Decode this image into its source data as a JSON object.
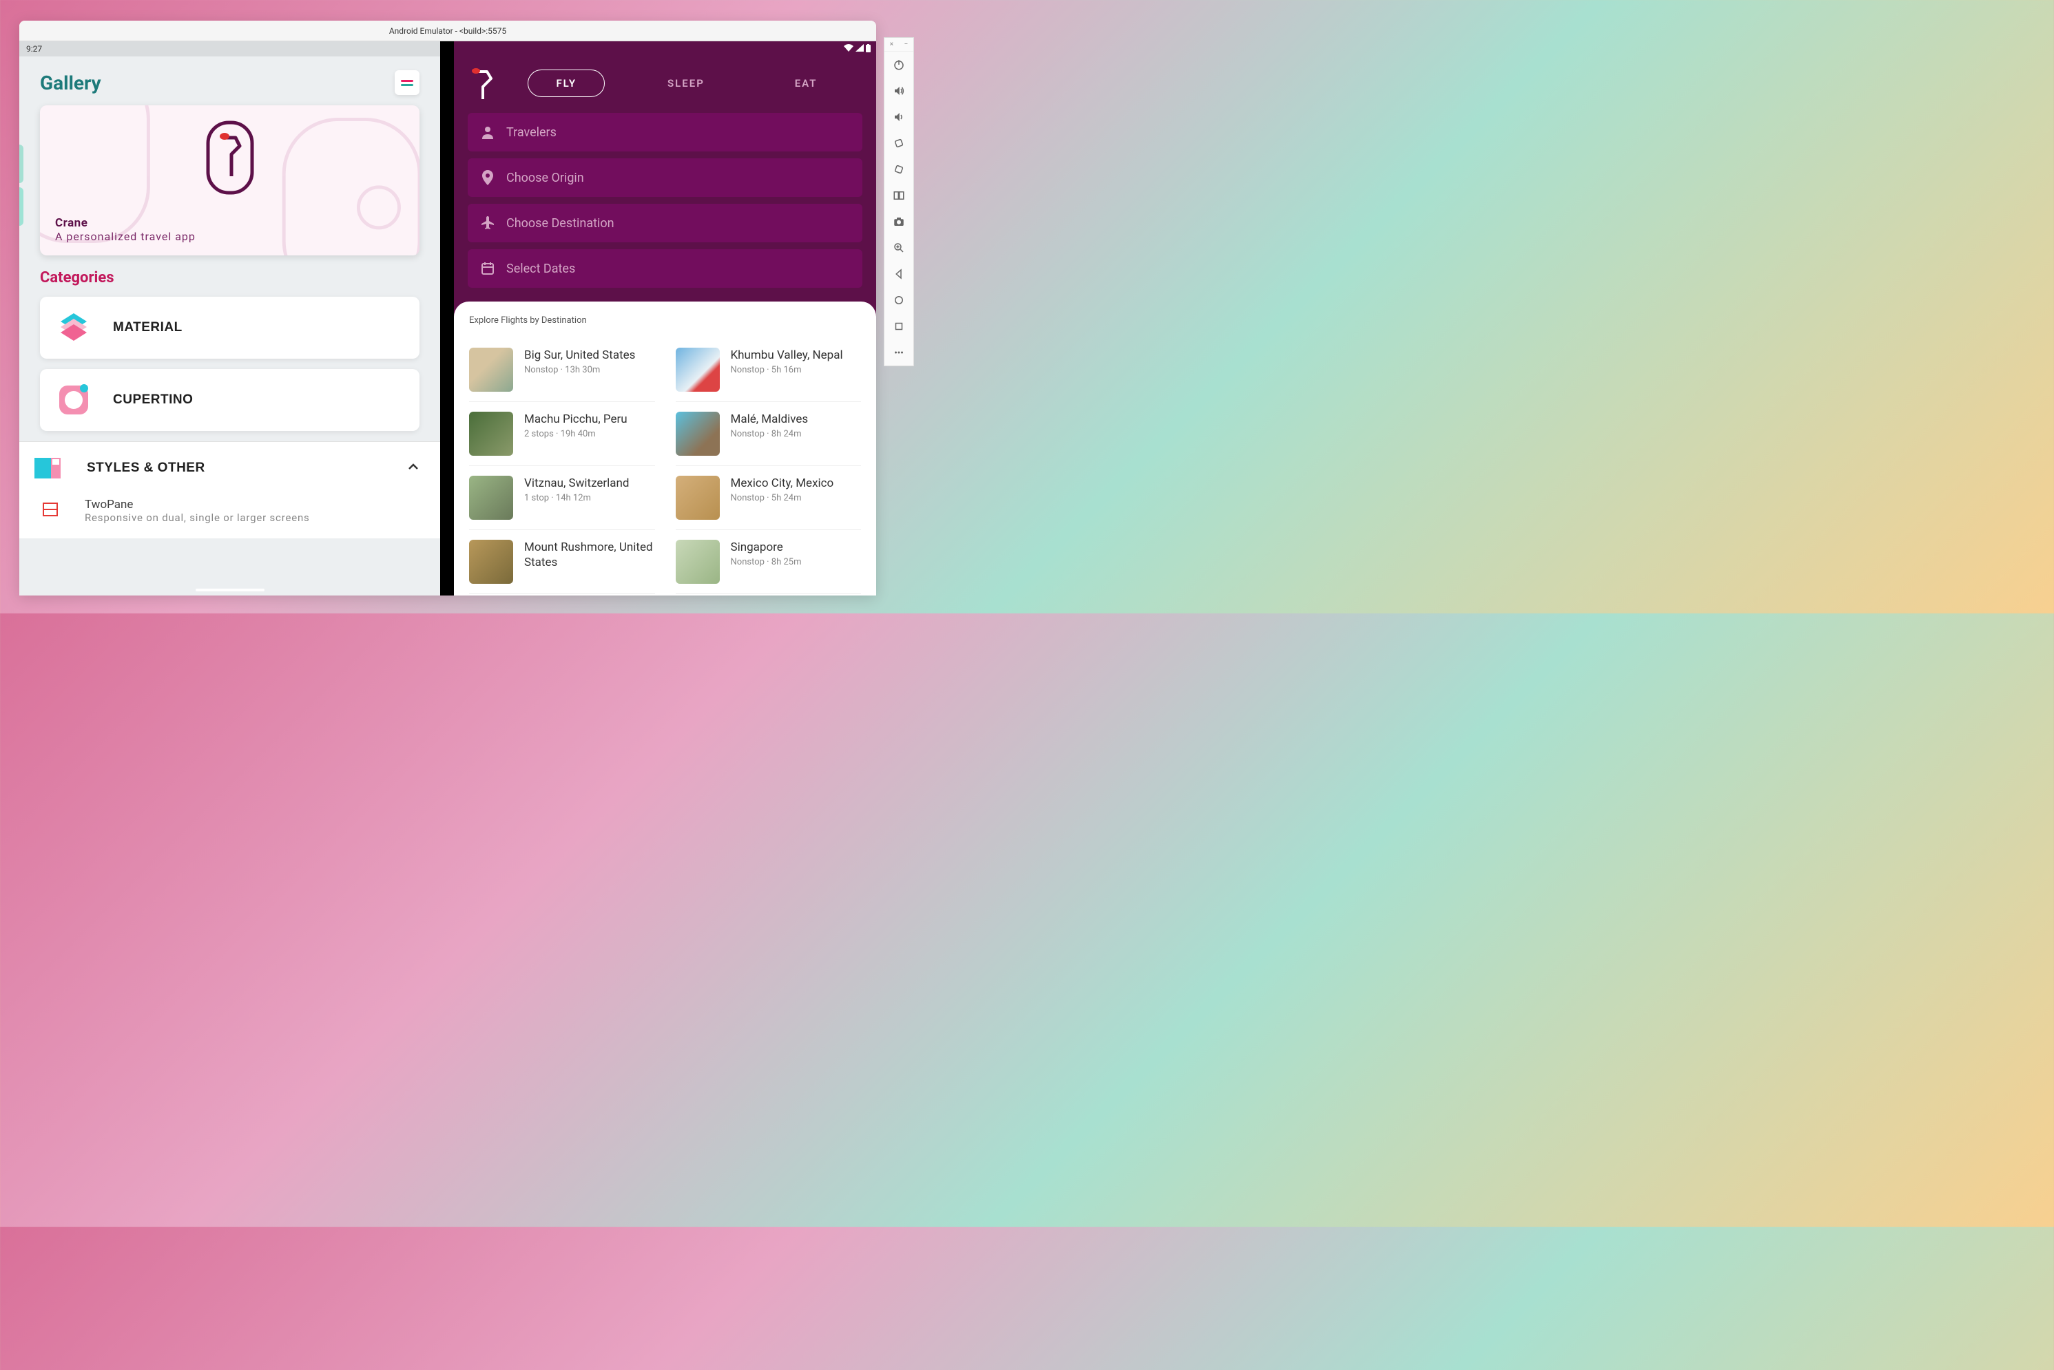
{
  "window": {
    "title": "Android Emulator - <build>:5575"
  },
  "gallery": {
    "status_time": "9:27",
    "title": "Gallery",
    "crane": {
      "name": "Crane",
      "subtitle": "A personalized travel app"
    },
    "categories_title": "Categories",
    "categories": [
      {
        "label": "MATERIAL"
      },
      {
        "label": "CUPERTINO"
      }
    ],
    "styles": {
      "label": "STYLES & OTHER",
      "items": [
        {
          "title": "TwoPane",
          "subtitle": "Responsive on dual, single or larger screens"
        }
      ]
    }
  },
  "crane_app": {
    "tabs": {
      "fly": "FLY",
      "sleep": "SLEEP",
      "eat": "EAT"
    },
    "inputs": {
      "travelers": "Travelers",
      "origin": "Choose Origin",
      "destination": "Choose Destination",
      "dates": "Select Dates"
    },
    "explore_title": "Explore Flights by Destination",
    "flights": [
      {
        "name": "Big Sur, United States",
        "detail": "Nonstop · 13h 30m",
        "cls": "bigsur"
      },
      {
        "name": "Khumbu Valley, Nepal",
        "detail": "Nonstop · 5h 16m",
        "cls": "khumbu"
      },
      {
        "name": "Machu Picchu, Peru",
        "detail": "2 stops · 19h 40m",
        "cls": "machu"
      },
      {
        "name": "Malé, Maldives",
        "detail": "Nonstop · 8h 24m",
        "cls": "male"
      },
      {
        "name": "Vitznau, Switzerland",
        "detail": "1 stop · 14h 12m",
        "cls": "vitznau"
      },
      {
        "name": "Mexico City, Mexico",
        "detail": "Nonstop · 5h 24m",
        "cls": "mexico"
      },
      {
        "name": "Mount Rushmore, United States",
        "detail": "",
        "cls": "rushmore"
      },
      {
        "name": "Singapore",
        "detail": "Nonstop · 8h 25m",
        "cls": "singapore"
      }
    ]
  }
}
